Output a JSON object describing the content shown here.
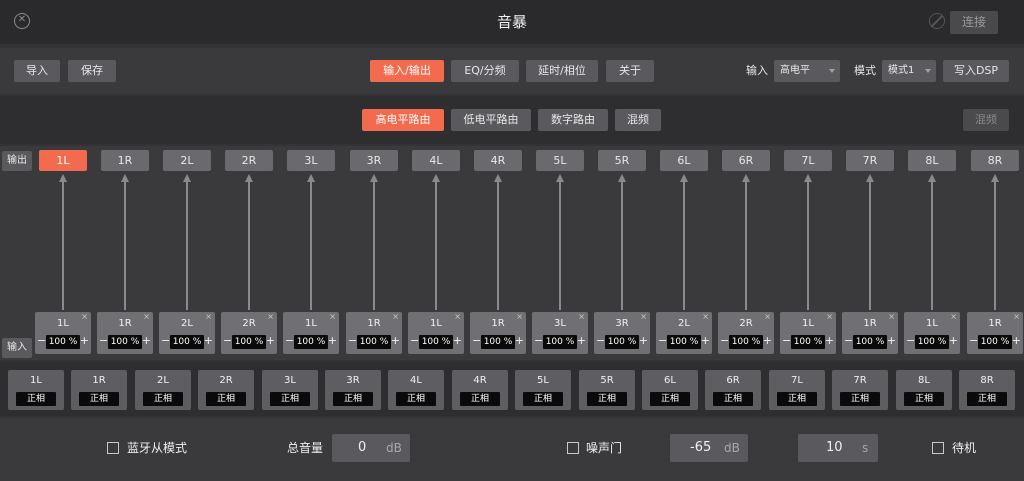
{
  "window": {
    "title": "音暴",
    "connect_label": "连接"
  },
  "toolbar": {
    "import_label": "导入",
    "save_label": "保存",
    "tabs": [
      "输入/输出",
      "EQ/分频",
      "延时/相位",
      "关于"
    ],
    "input_label": "输入",
    "input_value": "高电平",
    "mode_label": "模式",
    "mode_value": "模式1",
    "write_dsp_label": "写入DSP"
  },
  "route": {
    "tabs": [
      "高电平路由",
      "低电平路由",
      "数字路由",
      "混频"
    ],
    "mix_label": "混频"
  },
  "matrix": {
    "output_label": "输出",
    "input_label": "输入",
    "outputs": [
      "1L",
      "1R",
      "2L",
      "2R",
      "3L",
      "3R",
      "4L",
      "4R",
      "5L",
      "5R",
      "6L",
      "6R",
      "7L",
      "7R",
      "8L",
      "8R"
    ],
    "active_output": "1L",
    "inputs": [
      {
        "src": "1L",
        "pct": "100 %"
      },
      {
        "src": "1R",
        "pct": "100 %"
      },
      {
        "src": "2L",
        "pct": "100 %"
      },
      {
        "src": "2R",
        "pct": "100 %"
      },
      {
        "src": "1L",
        "pct": "100 %"
      },
      {
        "src": "1R",
        "pct": "100 %"
      },
      {
        "src": "1L",
        "pct": "100 %"
      },
      {
        "src": "1R",
        "pct": "100 %"
      },
      {
        "src": "3L",
        "pct": "100 %"
      },
      {
        "src": "3R",
        "pct": "100 %"
      },
      {
        "src": "2L",
        "pct": "100 %"
      },
      {
        "src": "2R",
        "pct": "100 %"
      },
      {
        "src": "1L",
        "pct": "100 %"
      },
      {
        "src": "1R",
        "pct": "100 %"
      },
      {
        "src": "1L",
        "pct": "100 %"
      },
      {
        "src": "1R",
        "pct": "100 %"
      }
    ],
    "minus": "−",
    "plus": "+",
    "close": "×"
  },
  "phase": {
    "channels": [
      "1L",
      "1R",
      "2L",
      "2R",
      "3L",
      "3R",
      "4L",
      "4R",
      "5L",
      "5R",
      "6L",
      "6R",
      "7L",
      "7R",
      "8L",
      "8R"
    ],
    "value": "正相"
  },
  "bottom": {
    "bt_slave_label": "蓝牙从模式",
    "master_volume_label": "总音量",
    "master_volume_value": "0",
    "master_volume_unit": "dB",
    "noise_gate_label": "噪声门",
    "noise_gate_value": "-65",
    "noise_gate_unit": "dB",
    "time_value": "10",
    "time_unit": "s",
    "standby_label": "待机"
  },
  "colors": {
    "accent": "#f26b4f",
    "background": "#333336"
  }
}
